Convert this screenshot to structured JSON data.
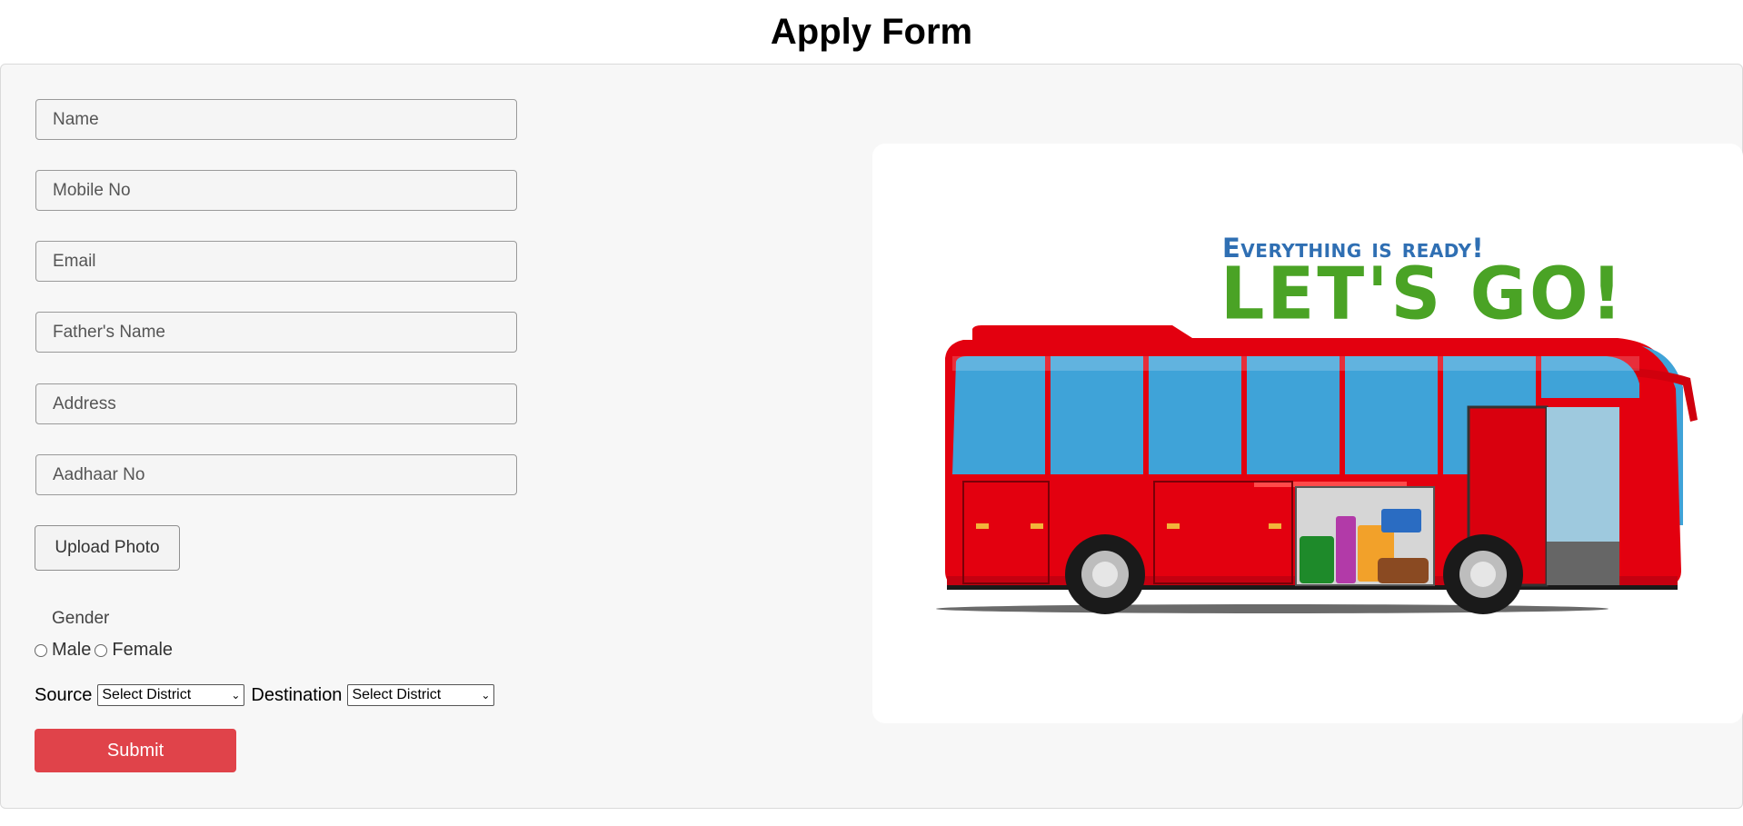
{
  "page": {
    "title": "Apply Form"
  },
  "form": {
    "fields": {
      "name": {
        "placeholder": "Name",
        "value": ""
      },
      "mobile": {
        "placeholder": "Mobile No",
        "value": ""
      },
      "email": {
        "placeholder": "Email",
        "value": ""
      },
      "father_name": {
        "placeholder": "Father's Name",
        "value": ""
      },
      "address": {
        "placeholder": "Address",
        "value": ""
      },
      "aadhaar": {
        "placeholder": "Aadhaar No",
        "value": ""
      }
    },
    "upload_label": "Upload Photo",
    "gender": {
      "label": "Gender",
      "options": [
        "Male",
        "Female"
      ],
      "selected": null
    },
    "route": {
      "source_label": "Source",
      "source_selected": "Select District",
      "destination_label": "Destination",
      "destination_selected": "Select District"
    },
    "submit_label": "Submit"
  },
  "illustration": {
    "tagline": "Everything is ready!",
    "headline": "LET'S GO!",
    "colors": {
      "tagline": "#2f6fb3",
      "headline": "#4aa325",
      "bus_body": "#e3000f",
      "windows": "#3fa3d8"
    }
  },
  "theme": {
    "submit_color": "#e0434a",
    "panel_background": "#f7f7f7"
  }
}
